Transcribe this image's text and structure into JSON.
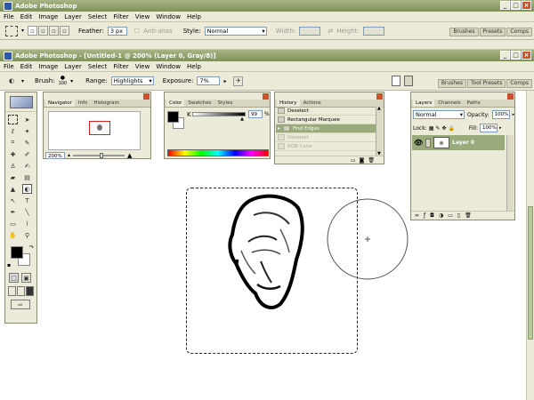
{
  "outer_window": {
    "title": "Adobe Photoshop",
    "menu": [
      "File",
      "Edit",
      "Image",
      "Layer",
      "Select",
      "Filter",
      "View",
      "Window",
      "Help"
    ],
    "options": {
      "feather_label": "Feather:",
      "feather_value": "3 px",
      "antialias_label": "Anti-alias",
      "style_label": "Style:",
      "style_value": "Normal",
      "width_label": "Width:",
      "height_label": "Height:"
    },
    "tabs": [
      "Brushes",
      "Presets",
      "Comps"
    ]
  },
  "inner_window": {
    "title": "Adobe Photoshop - [Untitled-1 @ 200% (Layer 0, Gray/8)]",
    "menu": [
      "File",
      "Edit",
      "Image",
      "Layer",
      "Select",
      "Filter",
      "View",
      "Window",
      "Help"
    ],
    "options": {
      "brush_label": "Brush:",
      "brush_size": "100",
      "range_label": "Range:",
      "range_value": "Highlights",
      "exposure_label": "Exposure:",
      "exposure_value": "7%"
    },
    "tabs": [
      "Brushes",
      "Tool Presets",
      "Comps"
    ]
  },
  "navigator": {
    "tabs": [
      "Navigator",
      "Info",
      "Histogram"
    ],
    "zoom": "200%"
  },
  "color": {
    "tabs": [
      "Color",
      "Swatches",
      "Styles"
    ],
    "channel_label": "K",
    "channel_value": "99",
    "unit": "%"
  },
  "history": {
    "tabs": [
      "History",
      "Actions"
    ],
    "items": [
      {
        "label": "Deselect",
        "state": "normal"
      },
      {
        "label": "Rectangular Marquee",
        "state": "normal"
      },
      {
        "label": "Find Edges",
        "state": "selected"
      },
      {
        "label": "Deselect",
        "state": "disabled"
      },
      {
        "label": "RGB Color",
        "state": "disabled"
      }
    ]
  },
  "layers": {
    "tabs": [
      "Layers",
      "Channels",
      "Paths"
    ],
    "blend_mode": "Normal",
    "opacity_label": "Opacity:",
    "opacity_value": "100%",
    "lock_label": "Lock:",
    "fill_label": "Fill:",
    "fill_value": "100%",
    "layer_name": "Layer 0"
  },
  "colors": {
    "title_bar": "#8a9c63",
    "chrome": "#ecead9",
    "selected_row": "#99ab7a",
    "close_button": "#c9522c"
  }
}
